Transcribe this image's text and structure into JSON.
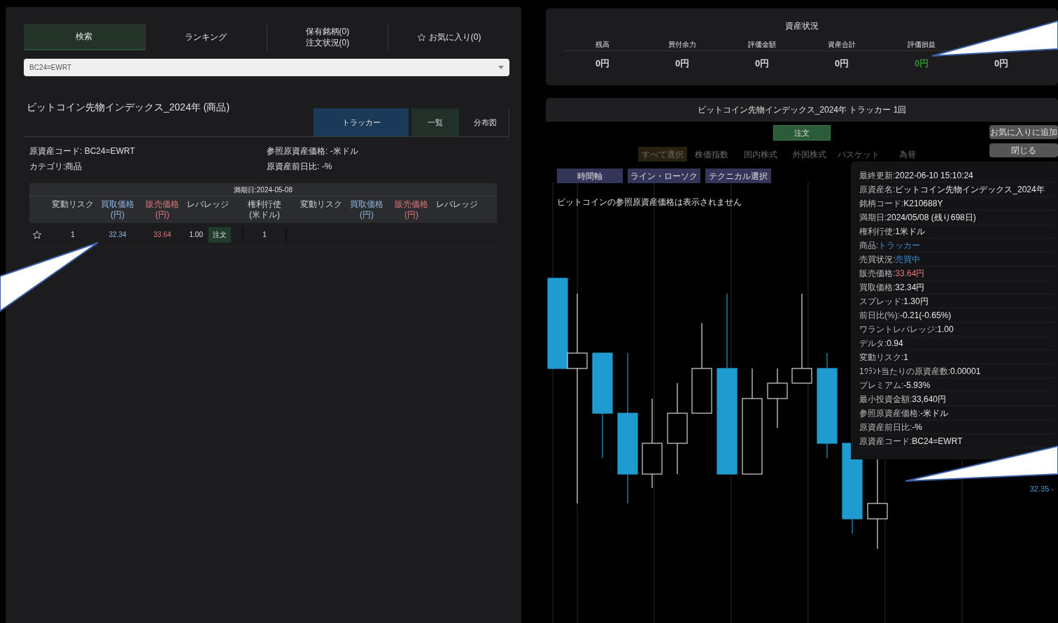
{
  "main_tabs": [
    {
      "label": "検索",
      "selected": true
    },
    {
      "label": "ランキング",
      "selected": false
    },
    {
      "label": "保有銘柄(0)\n注文状況(0)",
      "selected": false
    },
    {
      "label": "お気に入り(0)",
      "selected": false,
      "kind": "favorite"
    }
  ],
  "search": {
    "value": "BC24=EWRT"
  },
  "product": {
    "title": "ビットコイン先物インデックス_2024年 (商品)",
    "view_tabs": [
      {
        "label": "トラッカー",
        "kind": "tracker",
        "selected": false
      },
      {
        "label": "一覧",
        "kind": "plain",
        "selected": true
      },
      {
        "label": "分布図",
        "kind": "plain",
        "selected": false
      }
    ],
    "info": [
      "原資産コード: BC24=EWRT",
      "参照原資産価格: -米ドル",
      "カテゴリ:商品",
      "原資産前日比: -%"
    ]
  },
  "table": {
    "caption": "満期日:2024-05-08",
    "columns": [
      {
        "label": "変動リスク",
        "kind": "plain"
      },
      {
        "label": "買取価格\n(円)",
        "kind": "buy"
      },
      {
        "label": "販売価格\n(円)",
        "kind": "sell"
      },
      {
        "label": "レバレッジ",
        "kind": "plain"
      },
      {
        "label": "権利行使\n(米ドル)",
        "kind": "strike"
      },
      {
        "label": "変動リスク",
        "kind": "plain"
      },
      {
        "label": "買取価格\n(円)",
        "kind": "buy"
      },
      {
        "label": "販売価格\n(円)",
        "kind": "sell"
      },
      {
        "label": "レバレッジ",
        "kind": "plain"
      }
    ],
    "rows": [
      {
        "favorite": false,
        "risk": "1",
        "buy": "32.34",
        "sell": "33.64",
        "leverage": "1.00",
        "order": "注文",
        "strike": "1"
      }
    ]
  },
  "asset_status": {
    "title": "資産状況",
    "items": [
      {
        "label": "残高",
        "value": "0円",
        "color": "#d8d8d8"
      },
      {
        "label": "買付余力",
        "value": "0円",
        "color": "#d8d8d8"
      },
      {
        "label": "評価金額",
        "value": "0円",
        "color": "#d8d8d8"
      },
      {
        "label": "資産合計",
        "value": "0円",
        "color": "#d8d8d8"
      },
      {
        "label": "評価損益",
        "value": "0円",
        "color": "#2f8f2f"
      },
      {
        "value": "0円",
        "color": "#d8d8d8"
      }
    ]
  },
  "modal": {
    "title": "ビットコイン先物インデックス_2024年 トラッカー 1回",
    "order_button": "注文",
    "side_buttons": [
      "お気に入りに追加",
      "閉じる"
    ],
    "background_tabs": [
      {
        "label": "すべて選択",
        "selected": true
      },
      {
        "label": "株価指数",
        "selected": false
      },
      {
        "label": "国内株式",
        "selected": false
      },
      {
        "label": "外国株式",
        "selected": false
      },
      {
        "label": "バスケット",
        "selected": false
      },
      {
        "label": "為替",
        "selected": false
      }
    ],
    "chart_buttons": [
      "時間軸",
      "ライン・ローソク",
      "テクニカル選択"
    ],
    "notice": "ビットコインの参照原資産価格は表示されません",
    "price_label": "32.35 -",
    "details": [
      {
        "label": "最終更新:",
        "value": "2022-06-10 15:10:24",
        "kind": "plain"
      },
      {
        "label": "原資産名:",
        "value": "ビットコイン先物インデックス_2024年",
        "kind": "plain"
      },
      {
        "label": "銘柄コード:",
        "value": "K210688Y",
        "kind": "plain"
      },
      {
        "label": "満期日:",
        "value": "2024/05/08 (残り698日)",
        "kind": "plain"
      },
      {
        "label": "権利行使:",
        "value": "1米ドル",
        "kind": "plain"
      },
      {
        "label": "商品:",
        "value": "トラッカー",
        "kind": "link"
      },
      {
        "label": "売買状況:",
        "value": "売買中",
        "kind": "link"
      },
      {
        "label": "販売価格:",
        "value": "33.64円",
        "kind": "sell"
      },
      {
        "label": "買取価格:",
        "value": "32.34円",
        "kind": "plain"
      },
      {
        "label": "スプレッド:",
        "value": "1.30円",
        "kind": "plain"
      },
      {
        "label": "前日比(%):",
        "value": "-0.21(-0.65%)",
        "kind": "plain"
      },
      {
        "label": "ワラントレバレッジ:",
        "value": "1.00",
        "kind": "plain"
      },
      {
        "label": "デルタ:",
        "value": "0.94",
        "kind": "plain"
      },
      {
        "label": "変動リスク:",
        "value": "1",
        "kind": "plain"
      },
      {
        "label": "1ﾜﾗﾝﾄ当たりの原資産数:",
        "value": "0.00001",
        "kind": "plain"
      },
      {
        "label": "プレミアム:",
        "value": "-5.93%",
        "kind": "plain"
      },
      {
        "label": "最小投資金額:",
        "value": "33,640円",
        "kind": "plain"
      },
      {
        "label": "参照原資産価格:",
        "value": "-米ドル",
        "kind": "plain"
      },
      {
        "label": "原資産前日比:",
        "value": "-%",
        "kind": "plain"
      },
      {
        "label": "原資産コード:",
        "value": "BC24=EWRT",
        "kind": "plain"
      }
    ]
  }
}
